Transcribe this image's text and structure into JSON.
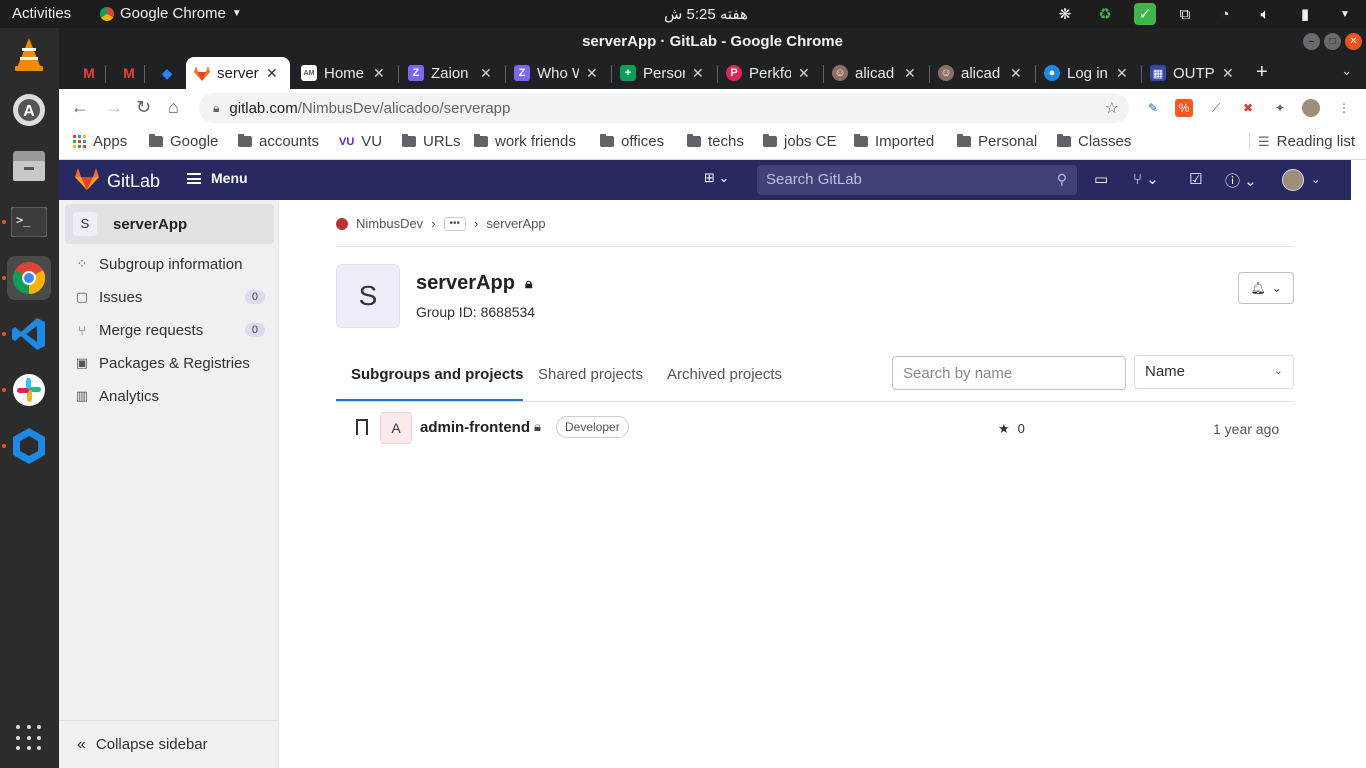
{
  "system": {
    "activities": "Activities",
    "app_name": "Google Chrome",
    "clock": "هفته 5:25 ش"
  },
  "window": {
    "title": "serverApp · GitLab - Google Chrome"
  },
  "tabs": [
    {
      "label": "",
      "favicon": "gmail-icon",
      "color": "#ea4335"
    },
    {
      "label": "",
      "favicon": "gmail-icon",
      "color": "#ea4335"
    },
    {
      "label": "",
      "favicon": "jira-icon",
      "color": "#2684ff"
    },
    {
      "label": "server",
      "favicon": "gitlab-icon",
      "color": "#fc6d26",
      "active": true
    },
    {
      "label": "Home",
      "favicon": "am-icon",
      "color": "#666666"
    },
    {
      "label": "Zaion",
      "favicon": "zaion-icon",
      "color": "#7b68ee"
    },
    {
      "label": "Who W",
      "favicon": "clickup-icon",
      "color": "#7b68ee"
    },
    {
      "label": "Person",
      "favicon": "sheets-icon",
      "color": "#0f9d58"
    },
    {
      "label": "Perkfo",
      "favicon": "perkfo-icon",
      "color": "#e0245e"
    },
    {
      "label": "alicad",
      "favicon": "avatar-icon",
      "color": "#8d6e63"
    },
    {
      "label": "alicad",
      "favicon": "avatar-icon",
      "color": "#8d6e63"
    },
    {
      "label": "Log in",
      "favicon": "login-icon",
      "color": "#1e88e5"
    },
    {
      "label": "OUTP",
      "favicon": "output-icon",
      "color": "#3949ab"
    }
  ],
  "address_bar": {
    "url_host": "gitlab.com",
    "url_path": "/NimbusDev/alicadoo/serverapp"
  },
  "bookmarks": [
    {
      "label": "Apps",
      "icon": "apps-grid-icon"
    },
    {
      "label": "Google",
      "icon": "folder-icon"
    },
    {
      "label": "accounts",
      "icon": "folder-icon"
    },
    {
      "label": "VU",
      "icon": "vu-icon"
    },
    {
      "label": "URLs",
      "icon": "folder-icon"
    },
    {
      "label": "work friends",
      "icon": "folder-icon"
    },
    {
      "label": "offices",
      "icon": "folder-icon"
    },
    {
      "label": "techs",
      "icon": "folder-icon"
    },
    {
      "label": "jobs CE",
      "icon": "folder-icon"
    },
    {
      "label": "Imported",
      "icon": "folder-icon"
    },
    {
      "label": "Personal",
      "icon": "folder-icon"
    },
    {
      "label": "Classes",
      "icon": "folder-icon"
    }
  ],
  "reading_list": "Reading list",
  "gitlab_nav": {
    "brand": "GitLab",
    "menu": "Menu",
    "search_placeholder": "Search GitLab"
  },
  "sidebar": {
    "context_avatar": "S",
    "context_name": "serverApp",
    "items": [
      {
        "label": "Subgroup information",
        "icon": "group-icon"
      },
      {
        "label": "Issues",
        "icon": "issues-icon",
        "badge": "0"
      },
      {
        "label": "Merge requests",
        "icon": "merge-request-icon",
        "badge": "0"
      },
      {
        "label": "Packages & Registries",
        "icon": "package-icon"
      },
      {
        "label": "Analytics",
        "icon": "analytics-icon"
      }
    ],
    "collapse": "Collapse sidebar"
  },
  "breadcrumb": {
    "root": "NimbusDev",
    "ellipsis": "•••",
    "current": "serverApp"
  },
  "group": {
    "avatar": "S",
    "name": "serverApp",
    "id_text": "Group ID: 8688534"
  },
  "group_tabs": {
    "subgroups": "Subgroups and projects",
    "shared": "Shared projects",
    "archived": "Archived projects",
    "search_placeholder": "Search by name",
    "sort_value": "Name"
  },
  "projects": [
    {
      "avatar": "A",
      "name": "admin-frontend",
      "role": "Developer",
      "stars": "0",
      "updated": "1 year ago"
    }
  ],
  "colors": {
    "gitlab_nav": "#292961",
    "accent": "#1f75cb",
    "ubuntu_orange": "#e95420"
  }
}
